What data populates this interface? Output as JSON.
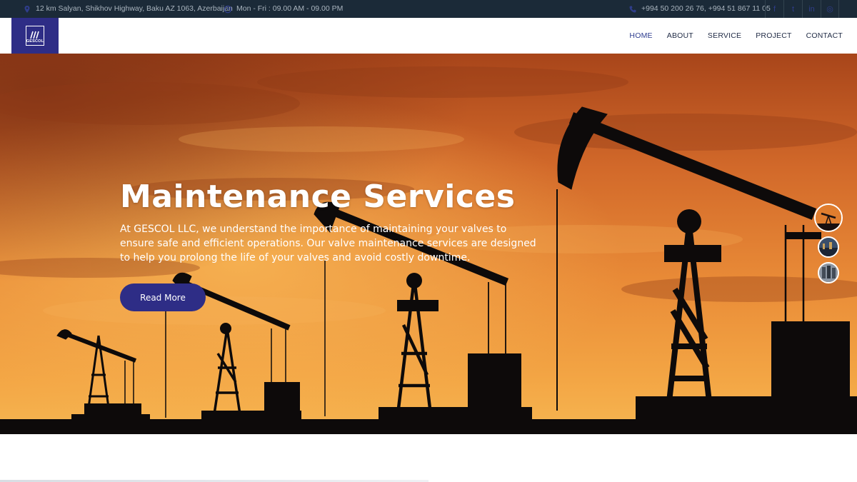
{
  "topbar": {
    "address": "12 km Salyan, Shikhov Highway, Baku AZ 1063, Azerbaijan",
    "hours": "Mon - Fri : 09.00 AM - 09.00 PM",
    "phone": "+994 50 200 26 76, +994 51 867 11 05",
    "social": [
      {
        "icon": "facebook-icon",
        "glyph": "f"
      },
      {
        "icon": "twitter-icon",
        "glyph": "t"
      },
      {
        "icon": "linkedin-icon",
        "glyph": "in"
      },
      {
        "icon": "instagram-icon",
        "glyph": "◎"
      }
    ]
  },
  "header": {
    "logo_text": "GESCOL",
    "nav": [
      {
        "label": "HOME",
        "active": true
      },
      {
        "label": "ABOUT",
        "active": false
      },
      {
        "label": "SERVICE",
        "active": false
      },
      {
        "label": "PROJECT",
        "active": false
      },
      {
        "label": "CONTACT",
        "active": false
      }
    ]
  },
  "hero": {
    "title": "Maintenance Services",
    "description": "At GESCOL LLC, we understand the importance of maintaining your valves to ensure safe and efficient operations. Our valve maintenance services are designed to help you prolong the life of your valves and avoid costly downtime.",
    "button_label": "Read More",
    "slides": 3,
    "active_slide": 1
  },
  "colors": {
    "brand": "#2e2d86",
    "topbar_bg": "#1b2a38",
    "sky_top": "#b4541c",
    "sky_mid": "#e88a33",
    "silhouette": "#0d0a0a"
  }
}
